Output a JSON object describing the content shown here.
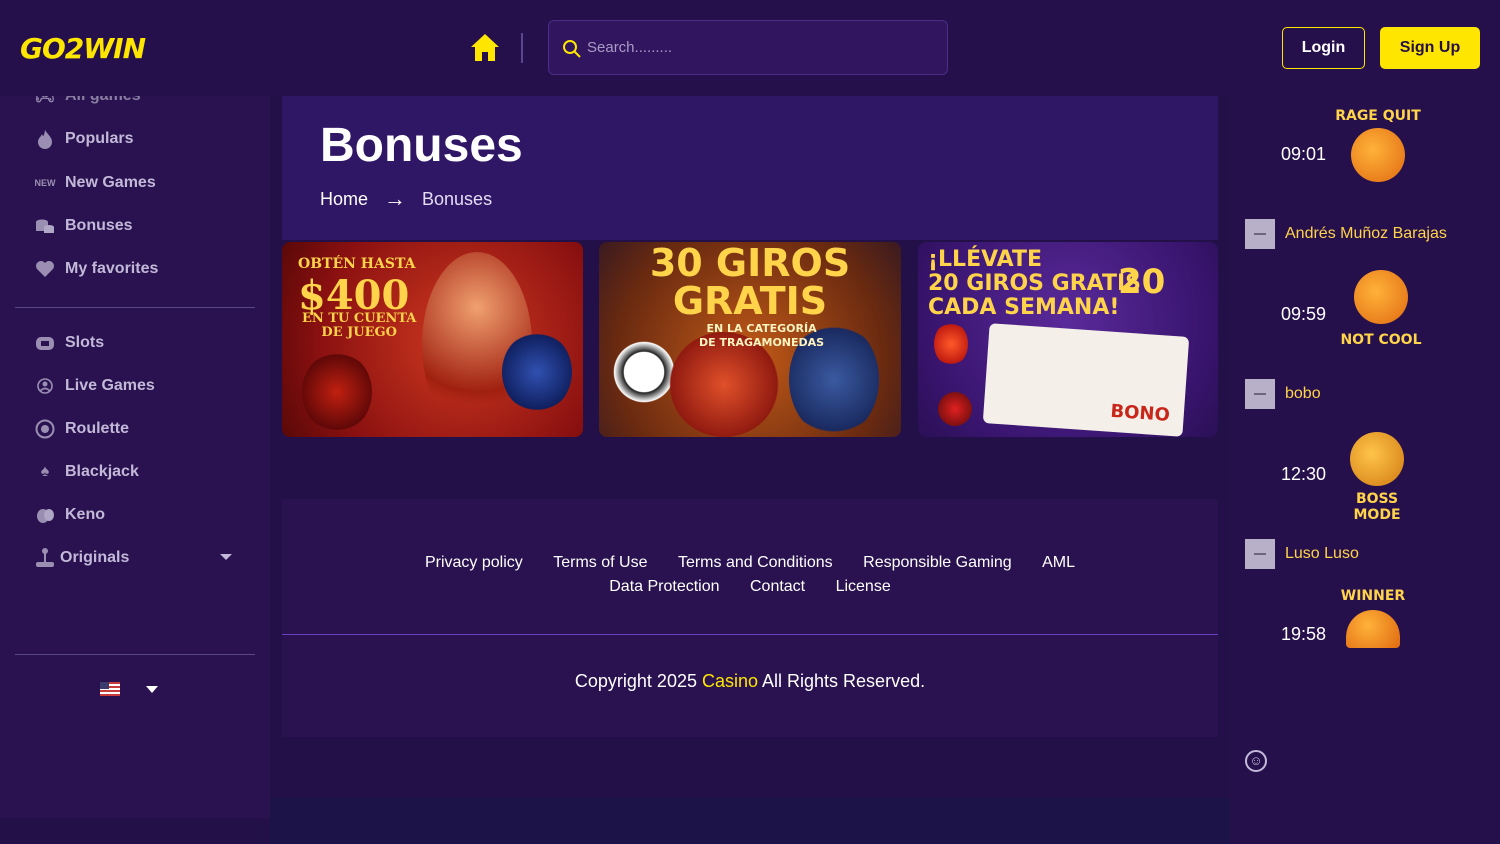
{
  "header": {
    "logo": "GO2WIN",
    "search_placeholder": "Search.........",
    "login_label": "Login",
    "signup_label": "Sign Up"
  },
  "sidebar": {
    "items_top": [
      {
        "label": "All games",
        "icon": "gamepad-icon"
      },
      {
        "label": "Populars",
        "icon": "flame-icon"
      },
      {
        "label": "New Games",
        "icon": "new-badge-icon",
        "badge": "NEW"
      },
      {
        "label": "Bonuses",
        "icon": "coins-icon"
      },
      {
        "label": "My favorites",
        "icon": "heart-icon"
      }
    ],
    "items_games": [
      {
        "label": "Slots",
        "icon": "slot-icon"
      },
      {
        "label": "Live Games",
        "icon": "dealer-icon"
      },
      {
        "label": "Roulette",
        "icon": "roulette-icon"
      },
      {
        "label": "Blackjack",
        "icon": "spade-icon"
      },
      {
        "label": "Keno",
        "icon": "keno-icon"
      },
      {
        "label": "Originals",
        "icon": "joystick-icon"
      }
    ],
    "language": "en-US"
  },
  "page": {
    "title": "Bonuses",
    "breadcrumb": {
      "home": "Home",
      "arrow": "→",
      "current": "Bonuses"
    }
  },
  "banners": [
    {
      "line1": "OBTÉN HASTA",
      "amount": "$400",
      "line3": "EN TU CUENTA",
      "line4": "DE JUEGO"
    },
    {
      "line1": "30 GIROS",
      "line2": "GRATIS",
      "line3": "EN LA CATEGORÍA",
      "line4": "DE TRAGAMONEDAS"
    },
    {
      "line1": "¡LLÉVATE",
      "line2": "20 GIROS GRATIS",
      "line3": "CADA SEMANA!",
      "badge": "20",
      "ticket": "BONO"
    }
  ],
  "footer": {
    "links_row1": [
      "Privacy policy",
      "Terms of Use",
      "Terms and Conditions",
      "Responsible Gaming",
      "AML"
    ],
    "links_row2": [
      "Data Protection",
      "Contact",
      "License"
    ],
    "copyright_pre": "Copyright 2025 ",
    "copyright_brand": "Casino",
    "copyright_post": " All Rights Reserved."
  },
  "chat": {
    "messages": [
      {
        "time": "09:01",
        "sticker": "RAGE QUIT"
      },
      {
        "user": "Andrés Muñoz Barajas"
      },
      {
        "time": "09:59",
        "sticker": "NOT COOL"
      },
      {
        "user": "bobo"
      },
      {
        "time": "12:30",
        "sticker": "BOSS MODE"
      },
      {
        "user": "Luso Luso"
      },
      {
        "time": "19:58",
        "sticker": "WINNER"
      }
    ]
  },
  "colors": {
    "accent": "#ffe600",
    "bg": "#241048",
    "panel": "#29124f"
  }
}
